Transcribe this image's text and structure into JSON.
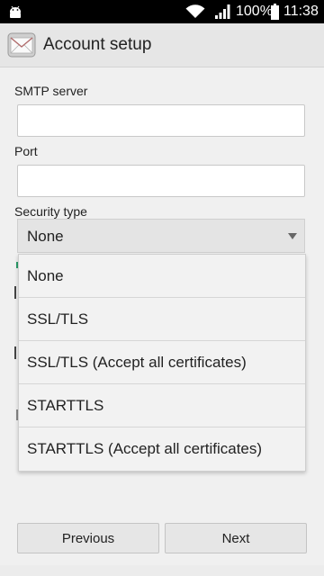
{
  "status_bar": {
    "battery": "100%",
    "time": "11:38",
    "icons": [
      "android-icon",
      "wifi-icon",
      "signal-icon",
      "battery-icon"
    ]
  },
  "app_bar": {
    "title": "Account setup",
    "icon": "mail-envelope-icon"
  },
  "form": {
    "smtp_label": "SMTP server",
    "smtp_value": "",
    "port_label": "Port",
    "port_value": "",
    "security_label": "Security type",
    "security_selected": "None"
  },
  "dropdown": {
    "options": [
      "None",
      "SSL/TLS",
      "SSL/TLS (Accept all certificates)",
      "STARTTLS",
      "STARTTLS (Accept all certificates)"
    ]
  },
  "buttons": {
    "previous": "Previous",
    "next": "Next"
  },
  "colors": {
    "status_bar": "#000000",
    "app_bar": "#e6e6e6",
    "background": "#f0f0f0",
    "accent": "#2a9d6a"
  }
}
